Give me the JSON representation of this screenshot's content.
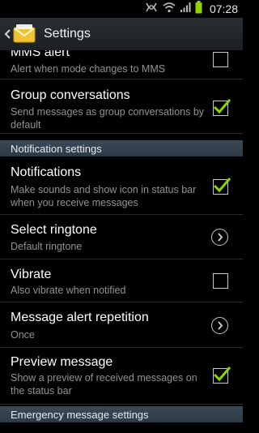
{
  "status_bar": {
    "time": "07:28"
  },
  "action_bar": {
    "title": "Settings"
  },
  "items": {
    "mms_alert": {
      "title": "MMS alert",
      "summary": "Alert when mode changes to MMS",
      "checked": false
    },
    "group_conversations": {
      "title": "Group conversations",
      "summary": "Send messages as group conversations by default",
      "checked": true
    },
    "notifications": {
      "title": "Notifications",
      "summary": "Make sounds and show icon in status bar when you receive messages",
      "checked": true
    },
    "select_ringtone": {
      "title": "Select ringtone",
      "summary": "Default ringtone"
    },
    "vibrate": {
      "title": "Vibrate",
      "summary": "Also vibrate when notified",
      "checked": false
    },
    "message_alert_repetition": {
      "title": "Message alert repetition",
      "summary": "Once"
    },
    "preview_message": {
      "title": "Preview message",
      "summary": "Show a preview of received messages on the status bar",
      "checked": true
    }
  },
  "sections": {
    "notification_settings": "Notification settings",
    "emergency_message_settings": "Emergency message settings"
  },
  "colors": {
    "accent": "#8fd400",
    "section_bg": "#34434e"
  }
}
